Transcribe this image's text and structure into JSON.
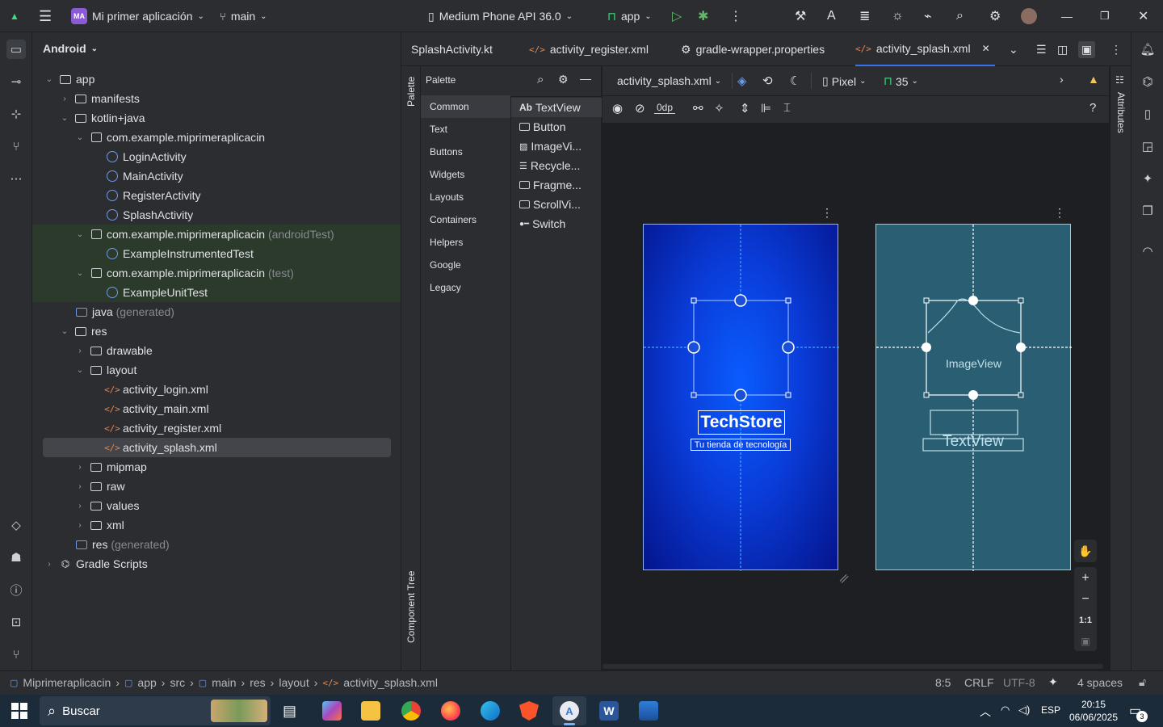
{
  "titlebar": {
    "project_badge": "MA",
    "project_name": "Mi primer aplicación",
    "branch": "main",
    "device": "Medium Phone API 36.0",
    "run_config": "app"
  },
  "project_panel": {
    "view_label": "Android",
    "rows": [
      {
        "label": "app",
        "suffix": ""
      },
      {
        "label": "manifests",
        "suffix": ""
      },
      {
        "label": "kotlin+java",
        "suffix": ""
      },
      {
        "label": "com.example.miprimeraplicacin",
        "suffix": ""
      },
      {
        "label": "LoginActivity",
        "suffix": ""
      },
      {
        "label": "MainActivity",
        "suffix": ""
      },
      {
        "label": "RegisterActivity",
        "suffix": ""
      },
      {
        "label": "SplashActivity",
        "suffix": ""
      },
      {
        "label": "com.example.miprimeraplicacin",
        "suffix": "(androidTest)"
      },
      {
        "label": "ExampleInstrumentedTest",
        "suffix": ""
      },
      {
        "label": "com.example.miprimeraplicacin",
        "suffix": "(test)"
      },
      {
        "label": "ExampleUnitTest",
        "suffix": ""
      },
      {
        "label": "java",
        "suffix": "(generated)"
      },
      {
        "label": "res",
        "suffix": ""
      },
      {
        "label": "drawable",
        "suffix": ""
      },
      {
        "label": "layout",
        "suffix": ""
      },
      {
        "label": "activity_login.xml",
        "suffix": ""
      },
      {
        "label": "activity_main.xml",
        "suffix": ""
      },
      {
        "label": "activity_register.xml",
        "suffix": ""
      },
      {
        "label": "activity_splash.xml",
        "suffix": ""
      },
      {
        "label": "mipmap",
        "suffix": ""
      },
      {
        "label": "raw",
        "suffix": ""
      },
      {
        "label": "values",
        "suffix": ""
      },
      {
        "label": "xml",
        "suffix": ""
      },
      {
        "label": "res",
        "suffix": "(generated)"
      },
      {
        "label": "Gradle Scripts",
        "suffix": ""
      }
    ]
  },
  "tabs": [
    "SplashActivity.kt",
    "activity_register.xml",
    "gradle-wrapper.properties",
    "activity_splash.xml"
  ],
  "palette": {
    "title": "Palette",
    "strip_label": "Palette",
    "component_tree_label": "Component Tree",
    "categories": [
      "Common",
      "Text",
      "Buttons",
      "Widgets",
      "Layouts",
      "Containers",
      "Helpers",
      "Google",
      "Legacy"
    ],
    "items": [
      "TextView",
      "Button",
      "ImageVi...",
      "Recycle...",
      "Fragme...",
      "ScrollVi...",
      "Switch"
    ],
    "textview_prefix": "Ab"
  },
  "design": {
    "file_dropdown": "activity_splash.xml",
    "device_dropdown": "Pixel",
    "api_dropdown": "35",
    "margin_value": "0dp",
    "attributes_label": "Attributes",
    "zoom_1to1": "1:1"
  },
  "preview": {
    "title": "TechStore",
    "subtitle": "Tu tienda de tecnología",
    "blueprint_image_label": "ImageView",
    "blueprint_text_label": "TextView"
  },
  "statusbar": {
    "breadcrumb": [
      "Miprimeraplicacin",
      "app",
      "src",
      "main",
      "res",
      "layout",
      "activity_splash.xml"
    ],
    "position": "8:5",
    "line_sep": "CRLF",
    "encoding": "UTF-8",
    "indent": "4 spaces"
  },
  "taskbar": {
    "search_placeholder": "Buscar",
    "lang": "ESP",
    "time": "20:15",
    "date": "06/06/2025",
    "notifications": "3"
  },
  "colors": {
    "accent": "#3574f0",
    "preview_blue": "#0a3cd8",
    "blueprint": "#2a5f73"
  }
}
